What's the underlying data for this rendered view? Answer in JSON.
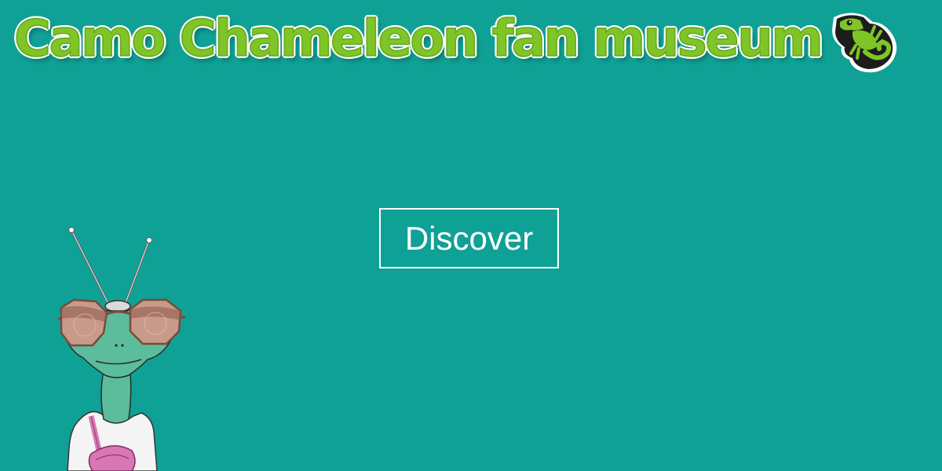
{
  "header": {
    "title": "Camo Chameleon fan museum",
    "logo_icon": "chameleon-logo-icon"
  },
  "main": {
    "cta_label": "Discover"
  },
  "illustration": {
    "icon": "chameleon-mascot-illustration"
  },
  "colors": {
    "background": "#0fa196",
    "title_green": "#7ec527",
    "button_border": "#ffffff",
    "chameleon_skin": "#5bbd9b",
    "bag_pink": "#d977b4"
  }
}
